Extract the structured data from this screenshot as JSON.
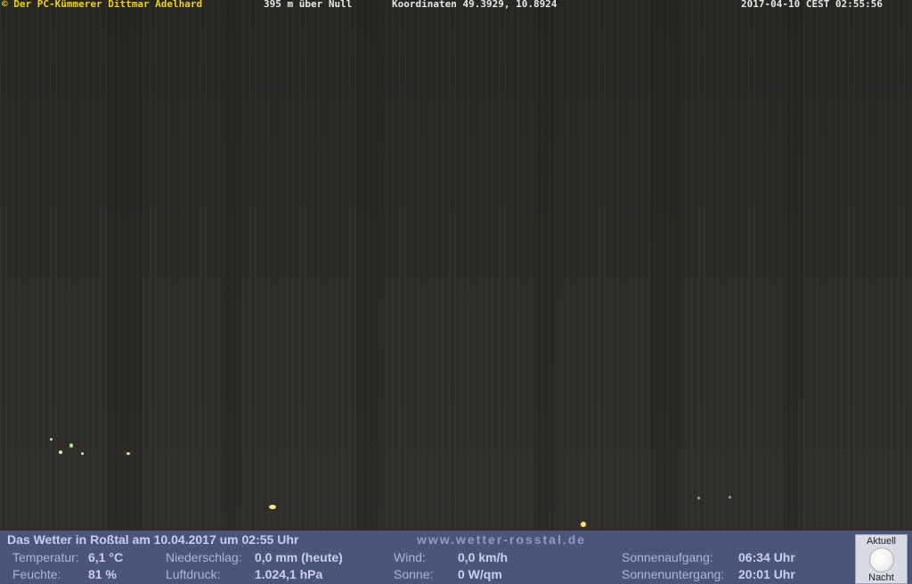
{
  "overlay": {
    "copyright": "© Der PC-Kümmerer Dittmar Adelhard",
    "altitude": "395 m über Null",
    "coordinates": "Koordinaten 49.3929, 10.8924",
    "datetime": "2017-04-10 CEST 02:55:56"
  },
  "panel": {
    "title": "Das Wetter in Roßtal am 10.04.2017 um 02:55 Uhr",
    "website": "www.wetter-rosstal.de",
    "temperature_label": "Temperatur:",
    "temperature_value": "6,1 °C",
    "humidity_label": "Feuchte:",
    "humidity_value": "81 %",
    "precip_label": "Niederschlag:",
    "precip_value": "0,0 mm (heute)",
    "pressure_label": "Luftdruck:",
    "pressure_value": "1.024,1 hPa",
    "wind_label": "Wind:",
    "wind_value": "0,0 km/h",
    "sun_label": "Sonne:",
    "sun_value": "0 W/qm",
    "sunrise_label": "Sonnenaufgang:",
    "sunrise_value": "06:34 Uhr",
    "sunset_label": "Sonnenuntergang:",
    "sunset_value": "20:01 Uhr"
  },
  "moon": {
    "top_label": "Aktuell",
    "bottom_label": "Nacht",
    "icon": "full-moon-icon"
  },
  "colors": {
    "overlay_copyright": "#f0d000",
    "panel_background": "#4a5578"
  }
}
